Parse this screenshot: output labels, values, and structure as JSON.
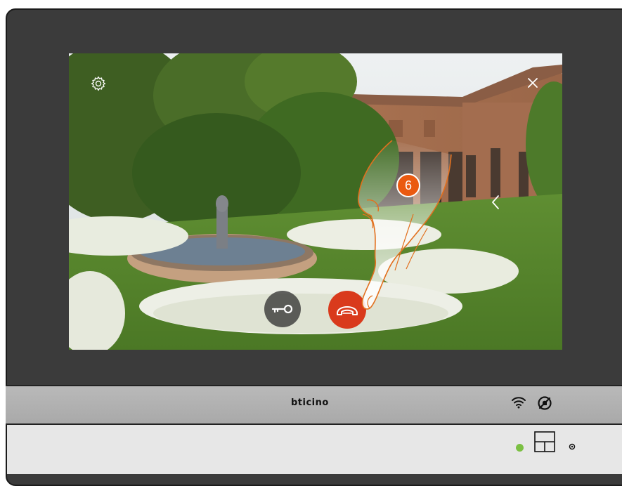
{
  "device": {
    "brand": "bticino"
  },
  "screen": {
    "step_number": "6",
    "settings_icon": "gear-icon",
    "close_icon": "close-icon",
    "back_icon": "chevron-left-icon"
  },
  "controls": {
    "door_unlock_icon": "key-icon",
    "hangup_icon": "phone-hangup-icon",
    "hangup_color": "#d93a1c"
  },
  "status": {
    "wifi_icon": "wifi-icon",
    "mute_icon": "mute-icon",
    "led_color": "#7bc043"
  }
}
